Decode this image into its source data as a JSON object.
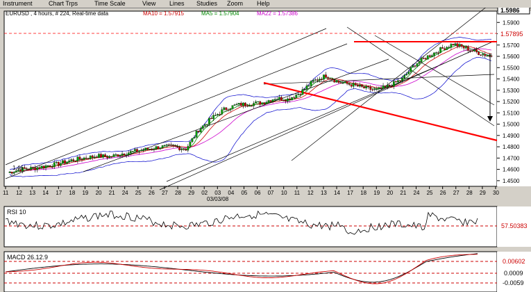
{
  "menu": [
    "Instrument",
    "Chart Trps",
    "Time Scale",
    "View",
    "Lines",
    "Studies",
    "Zoom",
    "Help"
  ],
  "main": {
    "info": {
      "symbol": "EURUSD , 4 hours, # 224, Real-time data",
      "ma10": "MA10 = 1.57915",
      "ma5": "MA5 = 1.57904",
      "ma22": "MA22 = 1.57386"
    },
    "y_ticks": [
      "1.5900",
      "1.5800",
      "1.5700",
      "1.5600",
      "1.5500",
      "1.5400",
      "1.5300",
      "1.5200",
      "1.5100",
      "1.5000",
      "1.4900",
      "1.4800",
      "1.4700",
      "1.4600",
      "1.4500"
    ],
    "price_tag": "1.5986",
    "price_tag2": "1.57895",
    "x_ticks": [
      "11",
      "12",
      "13",
      "14",
      "17",
      "18",
      "19",
      "20",
      "21",
      "24",
      "25",
      "26",
      "27",
      "28",
      "29",
      "02",
      "03",
      "04",
      "05",
      "06",
      "07",
      "10",
      "11",
      "12",
      "13",
      "14",
      "17",
      "18",
      "19",
      "20",
      "21",
      "24",
      "25",
      "26",
      "27",
      "28",
      "29",
      "30"
    ],
    "date_label": "03/03/08",
    "small_label": "1.46"
  },
  "rsi": {
    "title": "RSI 10",
    "value": "57.50383"
  },
  "macd": {
    "title": "MACD 26.12.9",
    "v1": "0.00602",
    "v2": "0.0009",
    "v3": "-0.0059"
  },
  "colors": {
    "ma10": "#cc0000",
    "ma5": "#008800",
    "ma22": "#cc00cc",
    "bollinger": "#0000cc",
    "trend_red": "#ff0000",
    "bull": "#00a000",
    "bear": "#cc0000"
  },
  "chart_data": [
    {
      "type": "candlestick",
      "title": "EURUSD , 4 hours, # 224, Real-time data",
      "ylim": [
        1.445,
        1.6
      ],
      "x": [
        "11",
        "12",
        "13",
        "14",
        "17",
        "18",
        "19",
        "20",
        "21",
        "24",
        "25",
        "26",
        "27",
        "28",
        "29",
        "02",
        "03",
        "04",
        "05",
        "06",
        "07",
        "10",
        "11",
        "12",
        "13",
        "14",
        "17",
        "18",
        "19",
        "20",
        "21",
        "24",
        "25",
        "26",
        "27",
        "28",
        "29",
        "30"
      ],
      "close": [
        1.457,
        1.46,
        1.461,
        1.463,
        1.465,
        1.468,
        1.47,
        1.472,
        1.471,
        1.474,
        1.476,
        1.478,
        1.48,
        1.48,
        1.478,
        1.495,
        1.505,
        1.513,
        1.517,
        1.518,
        1.519,
        1.523,
        1.522,
        1.528,
        1.538,
        1.543,
        1.537,
        1.535,
        1.532,
        1.53,
        1.534,
        1.54,
        1.553,
        1.56,
        1.566,
        1.571,
        1.567,
        1.563,
        1.56
      ],
      "series": [
        {
          "name": "MA10",
          "last": 1.57915
        },
        {
          "name": "MA5",
          "last": 1.57904
        },
        {
          "name": "MA22",
          "last": 1.57386
        }
      ]
    },
    {
      "type": "line",
      "title": "RSI 10",
      "ylim": [
        0,
        100
      ],
      "reference": 57.50383
    },
    {
      "type": "line",
      "title": "MACD 26.12.9",
      "ylim": [
        -0.009,
        0.009
      ],
      "reference_levels": [
        0.00602,
        0.0009,
        -0.0059
      ]
    }
  ]
}
